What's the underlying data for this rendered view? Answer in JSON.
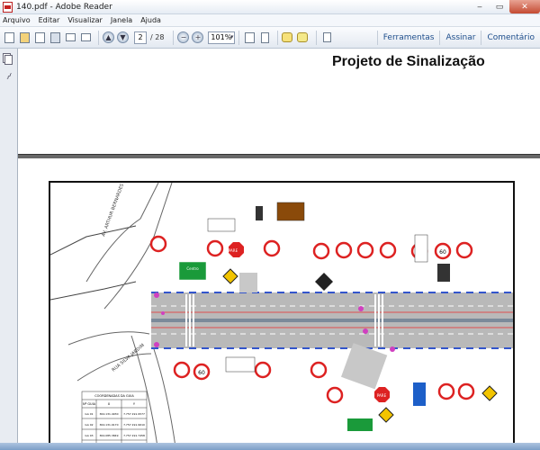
{
  "window": {
    "title": "140.pdf - Adobe Reader"
  },
  "menu": [
    "Arquivo",
    "Editar",
    "Visualizar",
    "Janela",
    "Ajuda"
  ],
  "toolbar": {
    "page_current": "2",
    "page_total": "/ 28",
    "zoom": "101%",
    "links": [
      "Ferramentas",
      "Assinar",
      "Comentário"
    ]
  },
  "document": {
    "page_title": "Projeto de Sinalização"
  },
  "drawing": {
    "table_title": "COORDENADAS DA GUIA",
    "table_headers": [
      "Nº GUIA",
      "X",
      "Y"
    ],
    "table_rows": [
      [
        "GA 01",
        "364.131.4930",
        "7.757.191.9577"
      ],
      [
        "GA 02",
        "364.131.9170",
        "7.757.191.9610"
      ],
      [
        "GA 03",
        "364.085.3849",
        "7.757.191.7458"
      ],
      [
        "GA 04",
        "364.131.8174",
        "7.757.191.7540"
      ]
    ],
    "sign_labels": [
      "PARE",
      "60",
      "PARE",
      "60"
    ],
    "dest_sign_labels": [
      "Centro",
      "Centro",
      "Centro"
    ]
  }
}
